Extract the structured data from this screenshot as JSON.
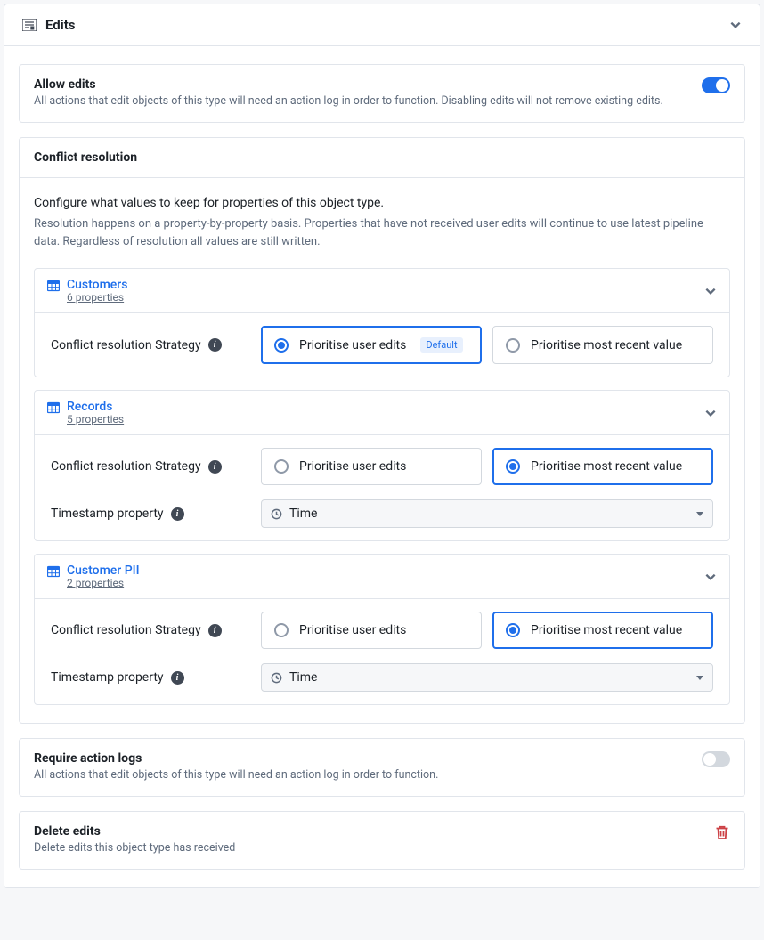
{
  "header": {
    "title": "Edits"
  },
  "allowEdits": {
    "title": "Allow edits",
    "desc": "All actions that edit objects of this type will need an action log in order to function. Disabling edits will not remove existing edits.",
    "enabled": true
  },
  "conflict": {
    "title": "Conflict resolution",
    "intro1": "Configure what values to keep for properties of this object type.",
    "intro2": "Resolution happens on a property-by-property basis. Properties that have not received user edits will continue to use latest pipeline data. Regardless of resolution all values are still written.",
    "strategyLabel": "Conflict resolution Strategy",
    "timestampLabel": "Timestamp property",
    "optUserEdits": "Prioritise user edits",
    "optMostRecent": "Prioritise most recent value",
    "defaultBadge": "Default",
    "datasets": {
      "customers": {
        "name": "Customers",
        "props": "6 properties",
        "selected": "user",
        "timestamp": null
      },
      "records": {
        "name": "Records",
        "props": "5 properties",
        "selected": "recent",
        "timestamp": "Time"
      },
      "pii": {
        "name": "Customer PII",
        "props": "2 properties",
        "selected": "recent",
        "timestamp": "Time"
      }
    }
  },
  "requireLogs": {
    "title": "Require action logs",
    "desc": "All actions that edit objects of this type will need an action log in order to function.",
    "enabled": false
  },
  "deleteEdits": {
    "title": "Delete edits",
    "desc": "Delete edits this object type has received"
  }
}
